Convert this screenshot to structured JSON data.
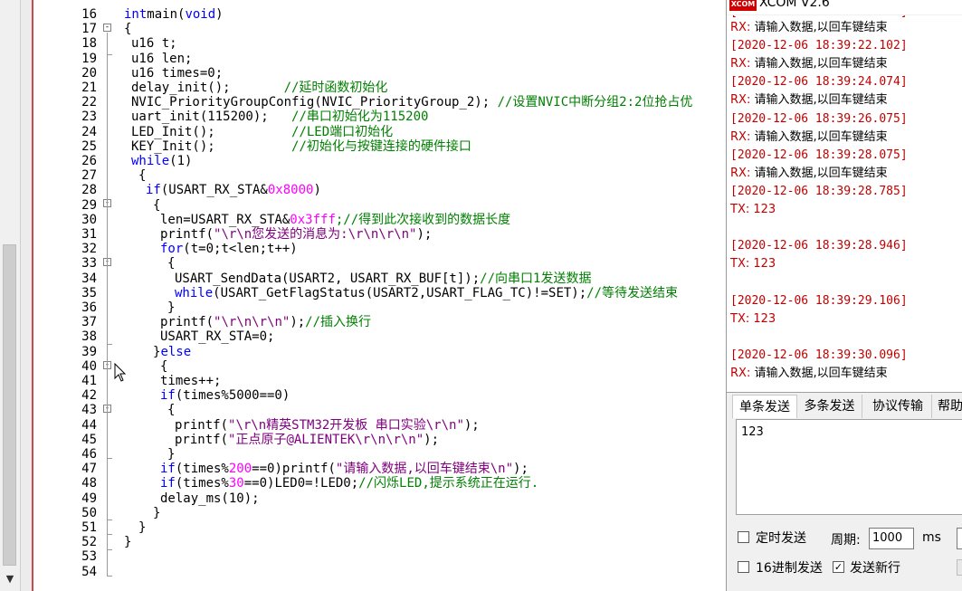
{
  "editor": {
    "lines": [
      {
        "num": "16",
        "segs": [
          [
            "kw",
            "int"
          ],
          [
            "",
            "main("
          ],
          [
            "kw",
            "void"
          ],
          [
            "",
            ")"
          ]
        ]
      },
      {
        "num": "17",
        "segs": [
          [
            "",
            "{"
          ]
        ]
      },
      {
        "num": "18",
        "segs": [
          [
            "",
            "u16 t;"
          ]
        ]
      },
      {
        "num": "19",
        "segs": [
          [
            "",
            "u16 len;"
          ]
        ]
      },
      {
        "num": "20",
        "segs": [
          [
            "",
            "u16 times=0;"
          ]
        ]
      },
      {
        "num": "21",
        "segs": [
          [
            "",
            "delay_init();       "
          ],
          [
            "cm",
            "//延时函数初始化"
          ]
        ]
      },
      {
        "num": "22",
        "segs": [
          [
            "",
            "NVIC_PriorityGroupConfig(NVIC_PriorityGroup_2); "
          ],
          [
            "cm",
            "//设置NVIC中断分组2:2位抢占优"
          ]
        ]
      },
      {
        "num": "23",
        "segs": [
          [
            "",
            "uart_init(115200);   "
          ],
          [
            "cm",
            "//串口初始化为115200"
          ]
        ]
      },
      {
        "num": "24",
        "segs": [
          [
            "",
            "LED_Init();          "
          ],
          [
            "cm",
            "//LED端口初始化"
          ]
        ]
      },
      {
        "num": "25",
        "segs": [
          [
            "",
            "KEY_Init();          "
          ],
          [
            "cm",
            "//初始化与按键连接的硬件接口"
          ]
        ]
      },
      {
        "num": "26",
        "segs": [
          [
            "kw",
            "while"
          ],
          [
            "",
            "(1)"
          ]
        ]
      },
      {
        "num": "27",
        "segs": [
          [
            "",
            "{"
          ]
        ]
      },
      {
        "num": "28",
        "segs": [
          [
            "kw",
            "if"
          ],
          [
            "",
            "(USART_RX_STA&"
          ],
          [
            "num",
            "0x8000"
          ],
          [
            "",
            ")"
          ]
        ]
      },
      {
        "num": "29",
        "segs": [
          [
            "",
            "{"
          ]
        ]
      },
      {
        "num": "30",
        "segs": [
          [
            "",
            "len=USART_RX_STA&"
          ],
          [
            "num",
            "0x3fff"
          ],
          [
            "cm",
            ";//得到此次接收到的数据长度"
          ]
        ]
      },
      {
        "num": "31",
        "segs": [
          [
            "",
            "printf("
          ],
          [
            "st",
            "\"\\r\\n您发送的消息为:\\r\\n\\r\\n\""
          ],
          [
            "",
            ");"
          ]
        ]
      },
      {
        "num": "32",
        "segs": [
          [
            "kw",
            "for"
          ],
          [
            "",
            "(t=0;t<len;t++)"
          ]
        ]
      },
      {
        "num": "33",
        "segs": [
          [
            "",
            "{"
          ]
        ]
      },
      {
        "num": "34",
        "segs": [
          [
            "",
            "USART_SendData(USART2, USART_RX_BUF[t]);"
          ],
          [
            "cm",
            "//向串口1发送数据"
          ]
        ]
      },
      {
        "num": "35",
        "segs": [
          [
            "kw",
            "while"
          ],
          [
            "",
            "(USART_GetFlagStatus(USART2,USART_FLAG_TC)!=SET);"
          ],
          [
            "cm",
            "//等待发送结束"
          ]
        ]
      },
      {
        "num": "36",
        "segs": [
          [
            "",
            "}"
          ]
        ]
      },
      {
        "num": "37",
        "segs": [
          [
            "",
            "printf("
          ],
          [
            "st",
            "\"\\r\\n\\r\\n\""
          ],
          [
            "",
            ");"
          ],
          [
            "cm",
            "//插入换行"
          ]
        ]
      },
      {
        "num": "38",
        "segs": [
          [
            "",
            "USART_RX_STA=0;"
          ]
        ]
      },
      {
        "num": "39",
        "segs": [
          [
            "",
            "}"
          ],
          [
            "kw",
            "else"
          ]
        ]
      },
      {
        "num": "40",
        "segs": [
          [
            "",
            "{"
          ]
        ]
      },
      {
        "num": "41",
        "segs": [
          [
            "",
            "times++;"
          ]
        ]
      },
      {
        "num": "42",
        "segs": [
          [
            "kw",
            "if"
          ],
          [
            "",
            "(times%5000==0)"
          ]
        ]
      },
      {
        "num": "43",
        "segs": [
          [
            "",
            "{"
          ]
        ]
      },
      {
        "num": "44",
        "segs": [
          [
            "",
            "printf("
          ],
          [
            "st",
            "\"\\r\\n精英STM32开发板 串口实验\\r\\n\""
          ],
          [
            "",
            ");"
          ]
        ]
      },
      {
        "num": "45",
        "segs": [
          [
            "",
            "printf("
          ],
          [
            "st",
            "\"正点原子@ALIENTEK\\r\\n\\r\\n\""
          ],
          [
            "",
            ");"
          ]
        ]
      },
      {
        "num": "46",
        "segs": [
          [
            "",
            "}"
          ]
        ]
      },
      {
        "num": "47",
        "segs": [
          [
            "kw",
            "if"
          ],
          [
            "",
            "(times%"
          ],
          [
            "num",
            "200"
          ],
          [
            "",
            "==0)printf("
          ],
          [
            "st",
            "\"请输入数据,以回车键结束\\n\""
          ],
          [
            "",
            ");"
          ]
        ]
      },
      {
        "num": "48",
        "segs": [
          [
            "kw",
            "if"
          ],
          [
            "",
            "(times%"
          ],
          [
            "num",
            "30"
          ],
          [
            "",
            "==0)LED0=!LED0;"
          ],
          [
            "cm",
            "//闪烁LED,提示系统正在运行."
          ]
        ]
      },
      {
        "num": "49",
        "segs": [
          [
            "",
            "delay_ms(10);"
          ]
        ]
      },
      {
        "num": "50",
        "segs": [
          [
            "",
            "}"
          ]
        ]
      },
      {
        "num": "51",
        "segs": [
          [
            "",
            "}"
          ]
        ]
      },
      {
        "num": "52",
        "segs": [
          [
            "",
            "}"
          ]
        ]
      },
      {
        "num": "53",
        "segs": []
      },
      {
        "num": "54",
        "segs": []
      }
    ]
  },
  "xcom": {
    "title": "XCOM V2.6",
    "logo": "XCOM",
    "receive": [
      {
        "kind": "rx",
        "label": "RX:",
        "text": " 请输入数据,以回车键结束"
      },
      {
        "kind": "ts",
        "text": "[2020-12-06 18:39:22.102]"
      },
      {
        "kind": "rx",
        "label": "RX:",
        "text": " 请输入数据,以回车键结束"
      },
      {
        "kind": "ts",
        "text": "[2020-12-06 18:39:24.074]"
      },
      {
        "kind": "rx",
        "label": "RX:",
        "text": " 请输入数据,以回车键结束"
      },
      {
        "kind": "ts",
        "text": "[2020-12-06 18:39:26.075]"
      },
      {
        "kind": "rx",
        "label": "RX:",
        "text": " 请输入数据,以回车键结束"
      },
      {
        "kind": "ts",
        "text": "[2020-12-06 18:39:28.075]"
      },
      {
        "kind": "rx",
        "label": "RX:",
        "text": " 请输入数据,以回车键结束"
      },
      {
        "kind": "ts",
        "text": "[2020-12-06 18:39:28.785]"
      },
      {
        "kind": "tx",
        "label": "TX:",
        "text": " 123"
      },
      {
        "kind": "blank",
        "text": ""
      },
      {
        "kind": "ts",
        "text": "[2020-12-06 18:39:28.946]"
      },
      {
        "kind": "tx",
        "label": "TX:",
        "text": " 123"
      },
      {
        "kind": "blank",
        "text": ""
      },
      {
        "kind": "ts",
        "text": "[2020-12-06 18:39:29.106]"
      },
      {
        "kind": "tx",
        "label": "TX:",
        "text": " 123"
      },
      {
        "kind": "blank",
        "text": ""
      },
      {
        "kind": "ts",
        "text": "[2020-12-06 18:39:30.096]"
      },
      {
        "kind": "rx",
        "label": "RX:",
        "text": " 请输入数据,以回车键结束"
      }
    ],
    "tabs": {
      "single": "单条发送",
      "multi": "多条发送",
      "protocol": "协议传输",
      "help": "帮助"
    },
    "send_text": "123",
    "timed_send_label": "定时发送",
    "period_label": "周期:",
    "period_value": "1000",
    "period_unit": "ms",
    "hex_send_label": "16进制发送",
    "newline_label": "发送新行",
    "newline_checked": "✓"
  }
}
